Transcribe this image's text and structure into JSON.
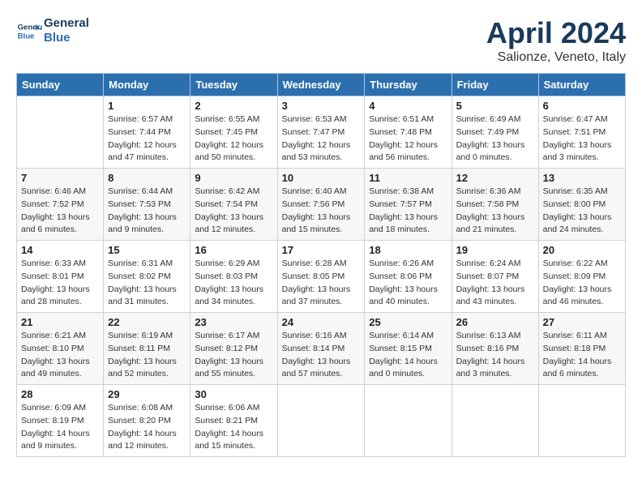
{
  "logo": {
    "line1": "General",
    "line2": "Blue"
  },
  "title": "April 2024",
  "location": "Salionze, Veneto, Italy",
  "days_header": [
    "Sunday",
    "Monday",
    "Tuesday",
    "Wednesday",
    "Thursday",
    "Friday",
    "Saturday"
  ],
  "weeks": [
    [
      {
        "num": "",
        "info": ""
      },
      {
        "num": "1",
        "info": "Sunrise: 6:57 AM\nSunset: 7:44 PM\nDaylight: 12 hours\nand 47 minutes."
      },
      {
        "num": "2",
        "info": "Sunrise: 6:55 AM\nSunset: 7:45 PM\nDaylight: 12 hours\nand 50 minutes."
      },
      {
        "num": "3",
        "info": "Sunrise: 6:53 AM\nSunset: 7:47 PM\nDaylight: 12 hours\nand 53 minutes."
      },
      {
        "num": "4",
        "info": "Sunrise: 6:51 AM\nSunset: 7:48 PM\nDaylight: 12 hours\nand 56 minutes."
      },
      {
        "num": "5",
        "info": "Sunrise: 6:49 AM\nSunset: 7:49 PM\nDaylight: 13 hours\nand 0 minutes."
      },
      {
        "num": "6",
        "info": "Sunrise: 6:47 AM\nSunset: 7:51 PM\nDaylight: 13 hours\nand 3 minutes."
      }
    ],
    [
      {
        "num": "7",
        "info": "Sunrise: 6:46 AM\nSunset: 7:52 PM\nDaylight: 13 hours\nand 6 minutes."
      },
      {
        "num": "8",
        "info": "Sunrise: 6:44 AM\nSunset: 7:53 PM\nDaylight: 13 hours\nand 9 minutes."
      },
      {
        "num": "9",
        "info": "Sunrise: 6:42 AM\nSunset: 7:54 PM\nDaylight: 13 hours\nand 12 minutes."
      },
      {
        "num": "10",
        "info": "Sunrise: 6:40 AM\nSunset: 7:56 PM\nDaylight: 13 hours\nand 15 minutes."
      },
      {
        "num": "11",
        "info": "Sunrise: 6:38 AM\nSunset: 7:57 PM\nDaylight: 13 hours\nand 18 minutes."
      },
      {
        "num": "12",
        "info": "Sunrise: 6:36 AM\nSunset: 7:58 PM\nDaylight: 13 hours\nand 21 minutes."
      },
      {
        "num": "13",
        "info": "Sunrise: 6:35 AM\nSunset: 8:00 PM\nDaylight: 13 hours\nand 24 minutes."
      }
    ],
    [
      {
        "num": "14",
        "info": "Sunrise: 6:33 AM\nSunset: 8:01 PM\nDaylight: 13 hours\nand 28 minutes."
      },
      {
        "num": "15",
        "info": "Sunrise: 6:31 AM\nSunset: 8:02 PM\nDaylight: 13 hours\nand 31 minutes."
      },
      {
        "num": "16",
        "info": "Sunrise: 6:29 AM\nSunset: 8:03 PM\nDaylight: 13 hours\nand 34 minutes."
      },
      {
        "num": "17",
        "info": "Sunrise: 6:28 AM\nSunset: 8:05 PM\nDaylight: 13 hours\nand 37 minutes."
      },
      {
        "num": "18",
        "info": "Sunrise: 6:26 AM\nSunset: 8:06 PM\nDaylight: 13 hours\nand 40 minutes."
      },
      {
        "num": "19",
        "info": "Sunrise: 6:24 AM\nSunset: 8:07 PM\nDaylight: 13 hours\nand 43 minutes."
      },
      {
        "num": "20",
        "info": "Sunrise: 6:22 AM\nSunset: 8:09 PM\nDaylight: 13 hours\nand 46 minutes."
      }
    ],
    [
      {
        "num": "21",
        "info": "Sunrise: 6:21 AM\nSunset: 8:10 PM\nDaylight: 13 hours\nand 49 minutes."
      },
      {
        "num": "22",
        "info": "Sunrise: 6:19 AM\nSunset: 8:11 PM\nDaylight: 13 hours\nand 52 minutes."
      },
      {
        "num": "23",
        "info": "Sunrise: 6:17 AM\nSunset: 8:12 PM\nDaylight: 13 hours\nand 55 minutes."
      },
      {
        "num": "24",
        "info": "Sunrise: 6:16 AM\nSunset: 8:14 PM\nDaylight: 13 hours\nand 57 minutes."
      },
      {
        "num": "25",
        "info": "Sunrise: 6:14 AM\nSunset: 8:15 PM\nDaylight: 14 hours\nand 0 minutes."
      },
      {
        "num": "26",
        "info": "Sunrise: 6:13 AM\nSunset: 8:16 PM\nDaylight: 14 hours\nand 3 minutes."
      },
      {
        "num": "27",
        "info": "Sunrise: 6:11 AM\nSunset: 8:18 PM\nDaylight: 14 hours\nand 6 minutes."
      }
    ],
    [
      {
        "num": "28",
        "info": "Sunrise: 6:09 AM\nSunset: 8:19 PM\nDaylight: 14 hours\nand 9 minutes."
      },
      {
        "num": "29",
        "info": "Sunrise: 6:08 AM\nSunset: 8:20 PM\nDaylight: 14 hours\nand 12 minutes."
      },
      {
        "num": "30",
        "info": "Sunrise: 6:06 AM\nSunset: 8:21 PM\nDaylight: 14 hours\nand 15 minutes."
      },
      {
        "num": "",
        "info": ""
      },
      {
        "num": "",
        "info": ""
      },
      {
        "num": "",
        "info": ""
      },
      {
        "num": "",
        "info": ""
      }
    ]
  ]
}
